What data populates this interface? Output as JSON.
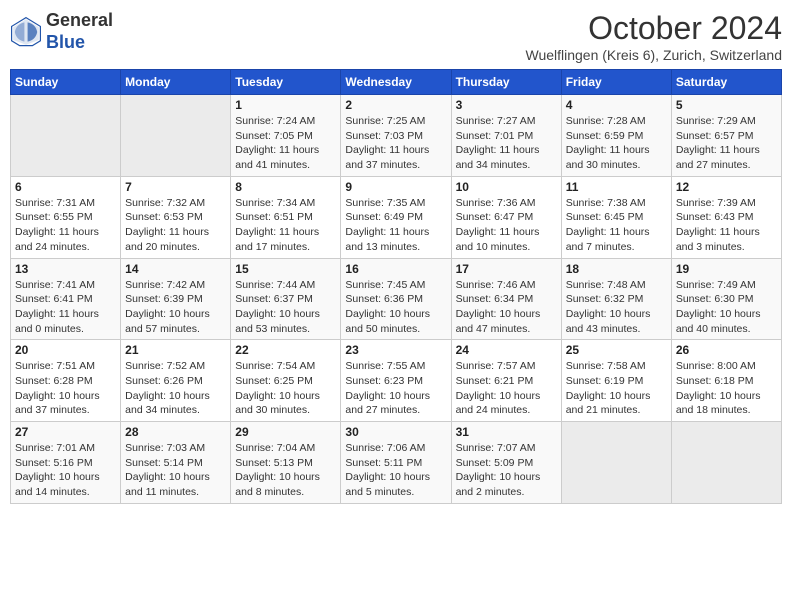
{
  "logo": {
    "general": "General",
    "blue": "Blue"
  },
  "title": "October 2024",
  "subtitle": "Wuelflingen (Kreis 6), Zurich, Switzerland",
  "weekdays": [
    "Sunday",
    "Monday",
    "Tuesday",
    "Wednesday",
    "Thursday",
    "Friday",
    "Saturday"
  ],
  "weeks": [
    [
      {
        "day": "",
        "info": ""
      },
      {
        "day": "",
        "info": ""
      },
      {
        "day": "1",
        "info": "Sunrise: 7:24 AM\nSunset: 7:05 PM\nDaylight: 11 hours and 41 minutes."
      },
      {
        "day": "2",
        "info": "Sunrise: 7:25 AM\nSunset: 7:03 PM\nDaylight: 11 hours and 37 minutes."
      },
      {
        "day": "3",
        "info": "Sunrise: 7:27 AM\nSunset: 7:01 PM\nDaylight: 11 hours and 34 minutes."
      },
      {
        "day": "4",
        "info": "Sunrise: 7:28 AM\nSunset: 6:59 PM\nDaylight: 11 hours and 30 minutes."
      },
      {
        "day": "5",
        "info": "Sunrise: 7:29 AM\nSunset: 6:57 PM\nDaylight: 11 hours and 27 minutes."
      }
    ],
    [
      {
        "day": "6",
        "info": "Sunrise: 7:31 AM\nSunset: 6:55 PM\nDaylight: 11 hours and 24 minutes."
      },
      {
        "day": "7",
        "info": "Sunrise: 7:32 AM\nSunset: 6:53 PM\nDaylight: 11 hours and 20 minutes."
      },
      {
        "day": "8",
        "info": "Sunrise: 7:34 AM\nSunset: 6:51 PM\nDaylight: 11 hours and 17 minutes."
      },
      {
        "day": "9",
        "info": "Sunrise: 7:35 AM\nSunset: 6:49 PM\nDaylight: 11 hours and 13 minutes."
      },
      {
        "day": "10",
        "info": "Sunrise: 7:36 AM\nSunset: 6:47 PM\nDaylight: 11 hours and 10 minutes."
      },
      {
        "day": "11",
        "info": "Sunrise: 7:38 AM\nSunset: 6:45 PM\nDaylight: 11 hours and 7 minutes."
      },
      {
        "day": "12",
        "info": "Sunrise: 7:39 AM\nSunset: 6:43 PM\nDaylight: 11 hours and 3 minutes."
      }
    ],
    [
      {
        "day": "13",
        "info": "Sunrise: 7:41 AM\nSunset: 6:41 PM\nDaylight: 11 hours and 0 minutes."
      },
      {
        "day": "14",
        "info": "Sunrise: 7:42 AM\nSunset: 6:39 PM\nDaylight: 10 hours and 57 minutes."
      },
      {
        "day": "15",
        "info": "Sunrise: 7:44 AM\nSunset: 6:37 PM\nDaylight: 10 hours and 53 minutes."
      },
      {
        "day": "16",
        "info": "Sunrise: 7:45 AM\nSunset: 6:36 PM\nDaylight: 10 hours and 50 minutes."
      },
      {
        "day": "17",
        "info": "Sunrise: 7:46 AM\nSunset: 6:34 PM\nDaylight: 10 hours and 47 minutes."
      },
      {
        "day": "18",
        "info": "Sunrise: 7:48 AM\nSunset: 6:32 PM\nDaylight: 10 hours and 43 minutes."
      },
      {
        "day": "19",
        "info": "Sunrise: 7:49 AM\nSunset: 6:30 PM\nDaylight: 10 hours and 40 minutes."
      }
    ],
    [
      {
        "day": "20",
        "info": "Sunrise: 7:51 AM\nSunset: 6:28 PM\nDaylight: 10 hours and 37 minutes."
      },
      {
        "day": "21",
        "info": "Sunrise: 7:52 AM\nSunset: 6:26 PM\nDaylight: 10 hours and 34 minutes."
      },
      {
        "day": "22",
        "info": "Sunrise: 7:54 AM\nSunset: 6:25 PM\nDaylight: 10 hours and 30 minutes."
      },
      {
        "day": "23",
        "info": "Sunrise: 7:55 AM\nSunset: 6:23 PM\nDaylight: 10 hours and 27 minutes."
      },
      {
        "day": "24",
        "info": "Sunrise: 7:57 AM\nSunset: 6:21 PM\nDaylight: 10 hours and 24 minutes."
      },
      {
        "day": "25",
        "info": "Sunrise: 7:58 AM\nSunset: 6:19 PM\nDaylight: 10 hours and 21 minutes."
      },
      {
        "day": "26",
        "info": "Sunrise: 8:00 AM\nSunset: 6:18 PM\nDaylight: 10 hours and 18 minutes."
      }
    ],
    [
      {
        "day": "27",
        "info": "Sunrise: 7:01 AM\nSunset: 5:16 PM\nDaylight: 10 hours and 14 minutes."
      },
      {
        "day": "28",
        "info": "Sunrise: 7:03 AM\nSunset: 5:14 PM\nDaylight: 10 hours and 11 minutes."
      },
      {
        "day": "29",
        "info": "Sunrise: 7:04 AM\nSunset: 5:13 PM\nDaylight: 10 hours and 8 minutes."
      },
      {
        "day": "30",
        "info": "Sunrise: 7:06 AM\nSunset: 5:11 PM\nDaylight: 10 hours and 5 minutes."
      },
      {
        "day": "31",
        "info": "Sunrise: 7:07 AM\nSunset: 5:09 PM\nDaylight: 10 hours and 2 minutes."
      },
      {
        "day": "",
        "info": ""
      },
      {
        "day": "",
        "info": ""
      }
    ]
  ]
}
